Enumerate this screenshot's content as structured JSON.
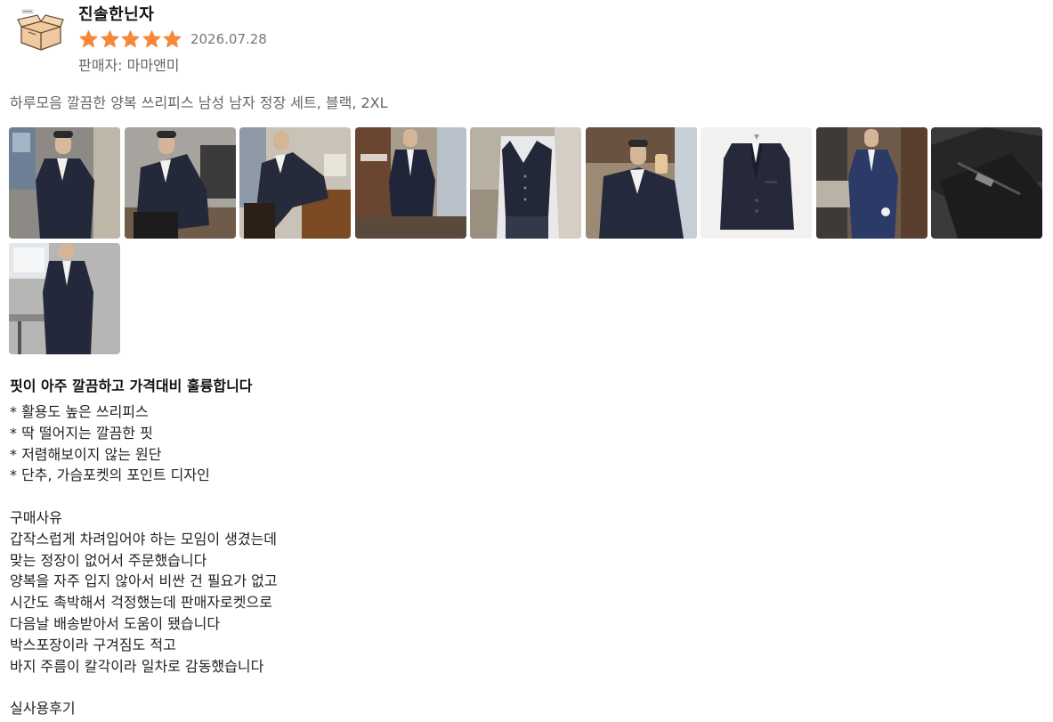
{
  "review": {
    "author": "진솔한닌자",
    "rating": 5,
    "rating_max": 5,
    "date": "2026.07.28",
    "seller": "판매자: 마마앤미",
    "product_option": "하루모음 깔끔한 양복 쓰리피스 남성 남자 정장 세트, 블랙, 2XL",
    "photo_count": 10,
    "headline": "핏이 아주 깔끔하고 가격대비 훌륭합니다",
    "body_lines": [
      "* 활용도 높은 쓰리피스",
      "* 딱 떨어지는 깔끔한 핏",
      "* 저렴해보이지 않는 원단",
      "* 단추, 가슴포켓의 포인트 디자인",
      "",
      "구매사유",
      "갑작스럽게 차려입어야 하는 모임이 생겼는데",
      "맞는 정장이 없어서 주문했습니다",
      "양복을 자주 입지 않아서 비싼 건 필요가 없고",
      "시간도 촉박해서 걱정했는데 판매자로켓으로",
      "다음날 배송받아서 도움이 됐습니다",
      "박스포장이라 구겨짐도 적고",
      "바지 주름이 칼각이라 일차로 감동했습니다",
      "",
      "실사용후기"
    ]
  },
  "colors": {
    "star": "#F5883B",
    "muted_text": "#666666",
    "suit": "#23283A"
  },
  "icons": {
    "avatar": "open-box-icon",
    "star": "star-icon"
  }
}
